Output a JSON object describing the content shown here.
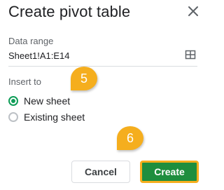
{
  "dialog": {
    "title": "Create pivot table",
    "close_icon": "close-icon"
  },
  "data_range": {
    "label": "Data range",
    "value": "Sheet1!A1:E14",
    "select_icon": "grid-select-icon"
  },
  "insert_to": {
    "label": "Insert to",
    "options": [
      {
        "label": "New sheet",
        "checked": true
      },
      {
        "label": "Existing sheet",
        "checked": false
      }
    ]
  },
  "callouts": {
    "step5": "5",
    "step6": "6",
    "color": "#f5ae1e"
  },
  "buttons": {
    "cancel": "Cancel",
    "create": "Create",
    "create_color": "#1e8e3e"
  }
}
